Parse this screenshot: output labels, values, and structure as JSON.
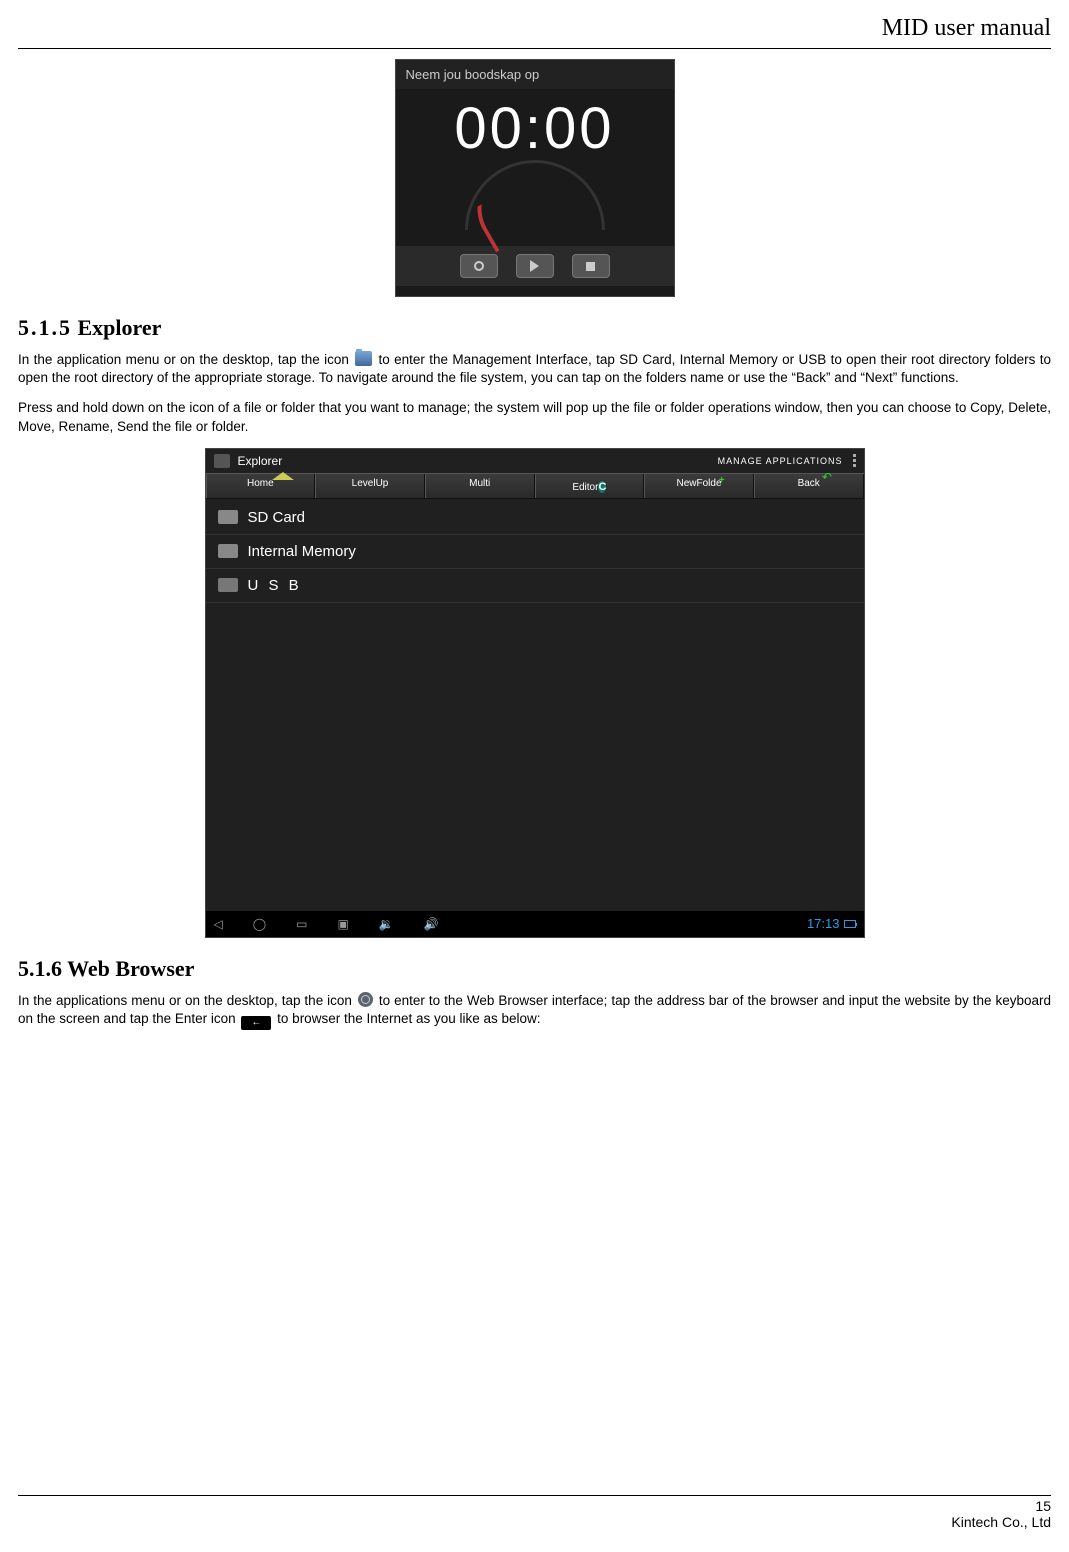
{
  "header": {
    "title": "MID user manual"
  },
  "recorder": {
    "title": "Neem jou boodskap op",
    "time": "00:00"
  },
  "section_515": {
    "number": "5.1.5",
    "title": "Explorer",
    "para1_a": "In the application menu or on the desktop, tap the icon ",
    "para1_b": " to enter the Management Interface, tap SD Card, Internal Memory or USB to open their root directory folders to open the root directory of the appropriate storage. To navigate around the file system, you can tap on the folders name or use the “Back” and “Next” functions.",
    "para2": "Press and hold down on the icon of a file or folder that you want to manage; the system will pop up the file or folder operations window, then you can choose to Copy, Delete, Move, Rename, Send the file or folder."
  },
  "explorer": {
    "app_title": "Explorer",
    "manage_apps": "MANAGE APPLICATIONS",
    "toolbar": [
      "Home",
      "LevelUp",
      "Multi",
      "Editor",
      "NewFolde",
      "Back"
    ],
    "rows": [
      "SD Card",
      "Internal Memory",
      "U S B"
    ],
    "clock": "17:13"
  },
  "section_516": {
    "number": "5.1.6",
    "title": "Web Browser",
    "para_a": "In the applications menu or on the desktop, tap the icon ",
    "para_b": " to enter to the Web Browser interface; tap the address bar of the browser and input the website by the keyboard on the screen and tap the Enter icon ",
    "para_c": " to browser the Internet as you like as below:",
    "enter_glyph": "←"
  },
  "footer": {
    "page": "15",
    "company": "Kintech Co., Ltd"
  }
}
